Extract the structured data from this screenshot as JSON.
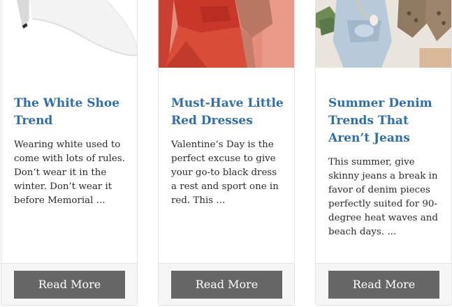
{
  "posts": [
    {
      "title": "The White Shoe Trend",
      "excerpt": "Wearing white used to come with lots of rules. Don’t wear it in the winter. Don’t wear it before Memorial ...",
      "button_label": "Read More",
      "image_icon": "white-shoe-image"
    },
    {
      "title": "Must-Have Little Red Dresses",
      "excerpt": "Valentine’s Day is the perfect excuse to give your go-to black dress a rest and sport one in red. This ...",
      "button_label": "Read More",
      "image_icon": "red-dress-image"
    },
    {
      "title": "Summer Denim Trends That Aren’t Jeans",
      "excerpt": "This summer, give skinny jeans a break in favor of denim pieces perfectly suited for 90-degree heat waves and beach days. ...",
      "button_label": "Read More",
      "image_icon": "denim-flatlay-image"
    }
  ],
  "colors": {
    "title": "#2e6ead",
    "button_bg": "#666666",
    "button_text": "#ffffff",
    "footer_bg": "#f6f6f6"
  }
}
